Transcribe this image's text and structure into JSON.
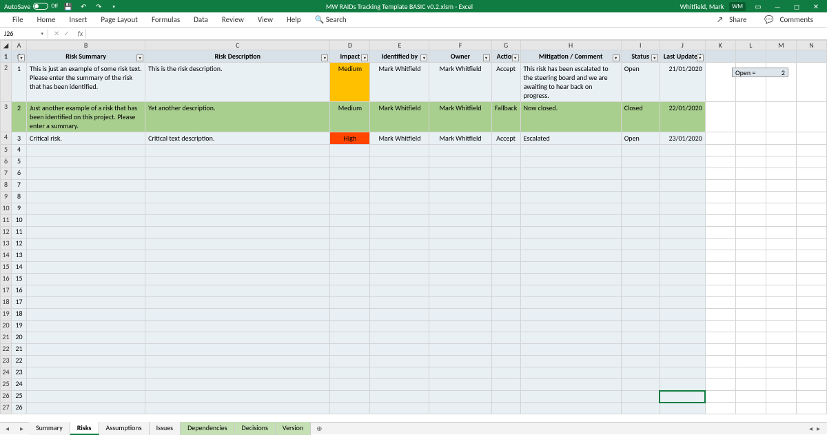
{
  "titlebar": {
    "autosave_label": "AutoSave",
    "autosave_state": "Off",
    "title": "MW RAIDs Tracking Template BASIC v0.2.xlsm  -  Excel",
    "user_name": "Whitfield, Mark",
    "user_initials": "WM"
  },
  "ribbon": {
    "tabs": [
      "File",
      "Home",
      "Insert",
      "Page Layout",
      "Formulas",
      "Data",
      "Review",
      "View",
      "Help"
    ],
    "search_placeholder": "Search",
    "share_label": "Share",
    "comments_label": "Comments"
  },
  "formula_bar": {
    "name_box": "J26",
    "formula": ""
  },
  "columns": [
    "A",
    "B",
    "C",
    "D",
    "E",
    "F",
    "G",
    "H",
    "I",
    "J",
    "K",
    "L",
    "M",
    "N"
  ],
  "headers": {
    "num": "#",
    "summary": "Risk Summary",
    "description": "Risk Description",
    "impact": "Impact",
    "identified_by": "Identified by",
    "owner": "Owner",
    "action": "Action",
    "mitigation": "Mitigation / Comment",
    "status": "Status",
    "last_updated": "Last Updated"
  },
  "rows": [
    {
      "num": "1",
      "summary": "This is just an example of some risk text. Please enter the summary of the risk that has been identified.",
      "description": "This is the risk description.",
      "impact": "Medium",
      "impact_class": "impact-med",
      "identified_by": "Mark Whitfield",
      "owner": "Mark Whitfield",
      "action": "Accept",
      "mitigation": "This risk has been escalated to the steering board and we are awaiting to hear back on progress.",
      "status": "Open",
      "last_updated": "21/01/2020",
      "row_class": ""
    },
    {
      "num": "2",
      "summary": "Just another example of a risk that has been identified on this project. Please enter a summary.",
      "description": "Yet another description.",
      "impact": "Medium",
      "impact_class": "impact-med",
      "identified_by": "Mark Whitfield",
      "owner": "Mark Whitfield",
      "action": "Fallback",
      "mitigation": "Now closed.",
      "status": "Closed",
      "last_updated": "22/01/2020",
      "row_class": "closed-row"
    },
    {
      "num": "3",
      "summary": "Critical risk.",
      "description": "Critical text description.",
      "impact": "High",
      "impact_class": "impact-high",
      "identified_by": "Mark Whitfield",
      "owner": "Mark Whitfield",
      "action": "Accept",
      "mitigation": "Escalated",
      "status": "Open",
      "last_updated": "23/01/2020",
      "row_class": ""
    }
  ],
  "info_box": {
    "label": "Open =",
    "value": "2"
  },
  "sheet_tabs": [
    "Summary",
    "Risks",
    "Assumptions",
    "Issues",
    "Dependencies",
    "Decisions",
    "Version"
  ],
  "active_tab": "Risks",
  "colored_tabs": [
    "Dependencies",
    "Decisions",
    "Version"
  ],
  "empty_row_count": 23
}
